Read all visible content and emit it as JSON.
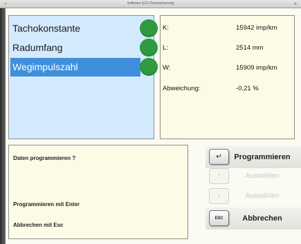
{
  "window": {
    "title": "Software ECU Parametrierung",
    "close_glyph": "×",
    "icon_glyph": "«"
  },
  "list": {
    "items": [
      {
        "label": "Tachokonstante",
        "selected": false,
        "status": "ok"
      },
      {
        "label": "Radumfang",
        "selected": false,
        "status": "ok"
      },
      {
        "label": "Wegimpulszahl",
        "selected": true,
        "status": "ok"
      }
    ]
  },
  "values": [
    {
      "key": "K:",
      "value": "15942 imp/km"
    },
    {
      "key": "L:",
      "value": "2514 mm"
    },
    {
      "key": "W:",
      "value": "15909 imp/km"
    },
    {
      "key": "Abweichung:",
      "value": "-0,21 %"
    }
  ],
  "prompt": {
    "question": "Daten programmieren ?",
    "enter_hint": "Programmieren mit Enter",
    "esc_hint": "Abbrechen mit Esc"
  },
  "buttons": {
    "program": {
      "key": "↵",
      "label": "Programmieren"
    },
    "select_up": {
      "key": "↑",
      "label": "Auswählen"
    },
    "select_down": {
      "key": "↓",
      "label": "Auswählen"
    },
    "cancel": {
      "key": "ESC",
      "label": "Abbrechen"
    }
  },
  "colors": {
    "list_bg": "#d4ebff",
    "selection": "#3f8fdc",
    "status_ok": "#2f9a42",
    "values_bg": "#fcfce6"
  }
}
